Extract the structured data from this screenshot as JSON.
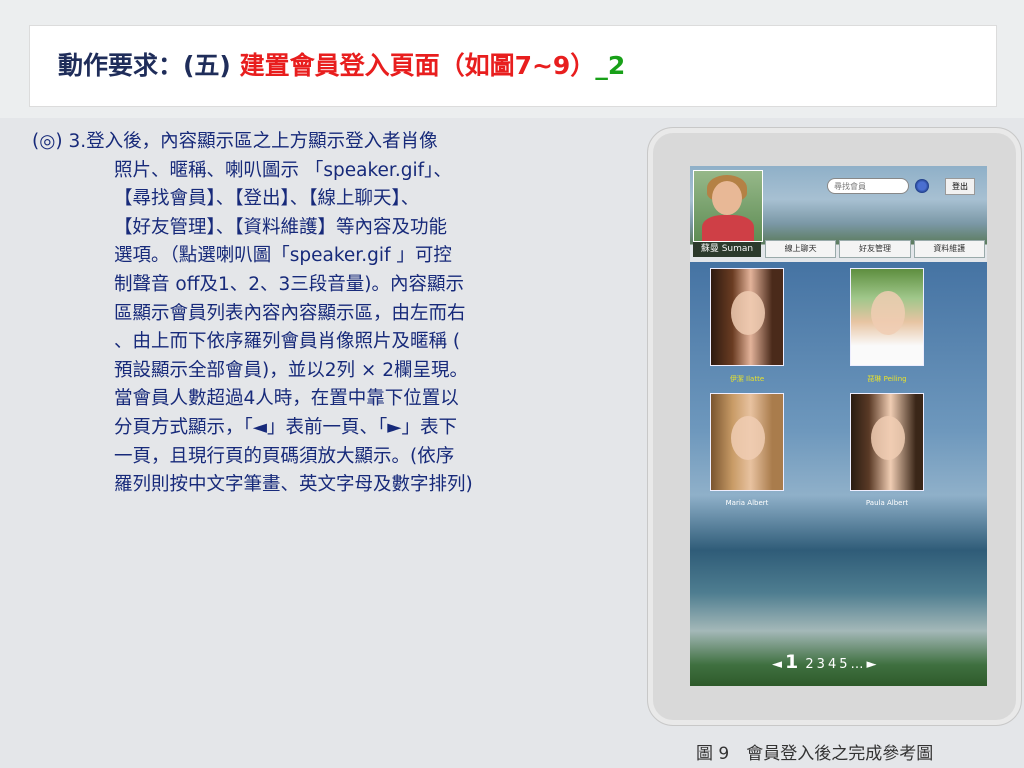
{
  "slide": {
    "title": {
      "prefix": "動作要求：(五) ",
      "highlight": "建置會員登入頁面（如圖7~9）",
      "underscore": "_",
      "suffix": "2"
    },
    "body_lines": [
      "(◎) 3.登入後，內容顯示區之上方顯示登入者肖像",
      "照片、暱稱、喇叭圖示 「speaker.gif」、",
      "【尋找會員】、【登出】、【線上聊天】、",
      "【好友管理】、【資料維護】等內容及功能",
      "選項。（點選喇叭圖「speaker.gif 」可控",
      "制聲音 off及1、2、3三段音量)。內容顯示",
      "區顯示會員列表內容內容顯示區，由左而右",
      "、由上而下依序羅列會員肖像照片及暱稱 (",
      "預設顯示全部會員)，並以2列 × 2欄呈現。",
      "當會員人數超過4人時，在置中靠下位置以",
      "分頁方式顯示，「◄」表前一頁、「►」表下",
      "一頁，且現行頁的頁碼須放大顯示。(依序",
      "羅列則按中文字筆畫、英文字母及數字排列)"
    ],
    "caption": "圖 9　會員登入後之完成參考圖"
  },
  "mock": {
    "nickname": "蘇曼 Suman",
    "search_placeholder": "尋找會員",
    "logout_label": "登出",
    "nav": [
      "線上聊天",
      "好友管理",
      "資料維護"
    ],
    "members": [
      {
        "name": "伊潔 Ilatte"
      },
      {
        "name": "琵琳 Peiling"
      },
      {
        "name": "Maria Albert"
      },
      {
        "name": "Paula Albert"
      }
    ],
    "pager": {
      "prev": "◄",
      "current": "1",
      "pages": [
        "2",
        "3",
        "4",
        "5",
        "…"
      ],
      "next": "►"
    }
  }
}
